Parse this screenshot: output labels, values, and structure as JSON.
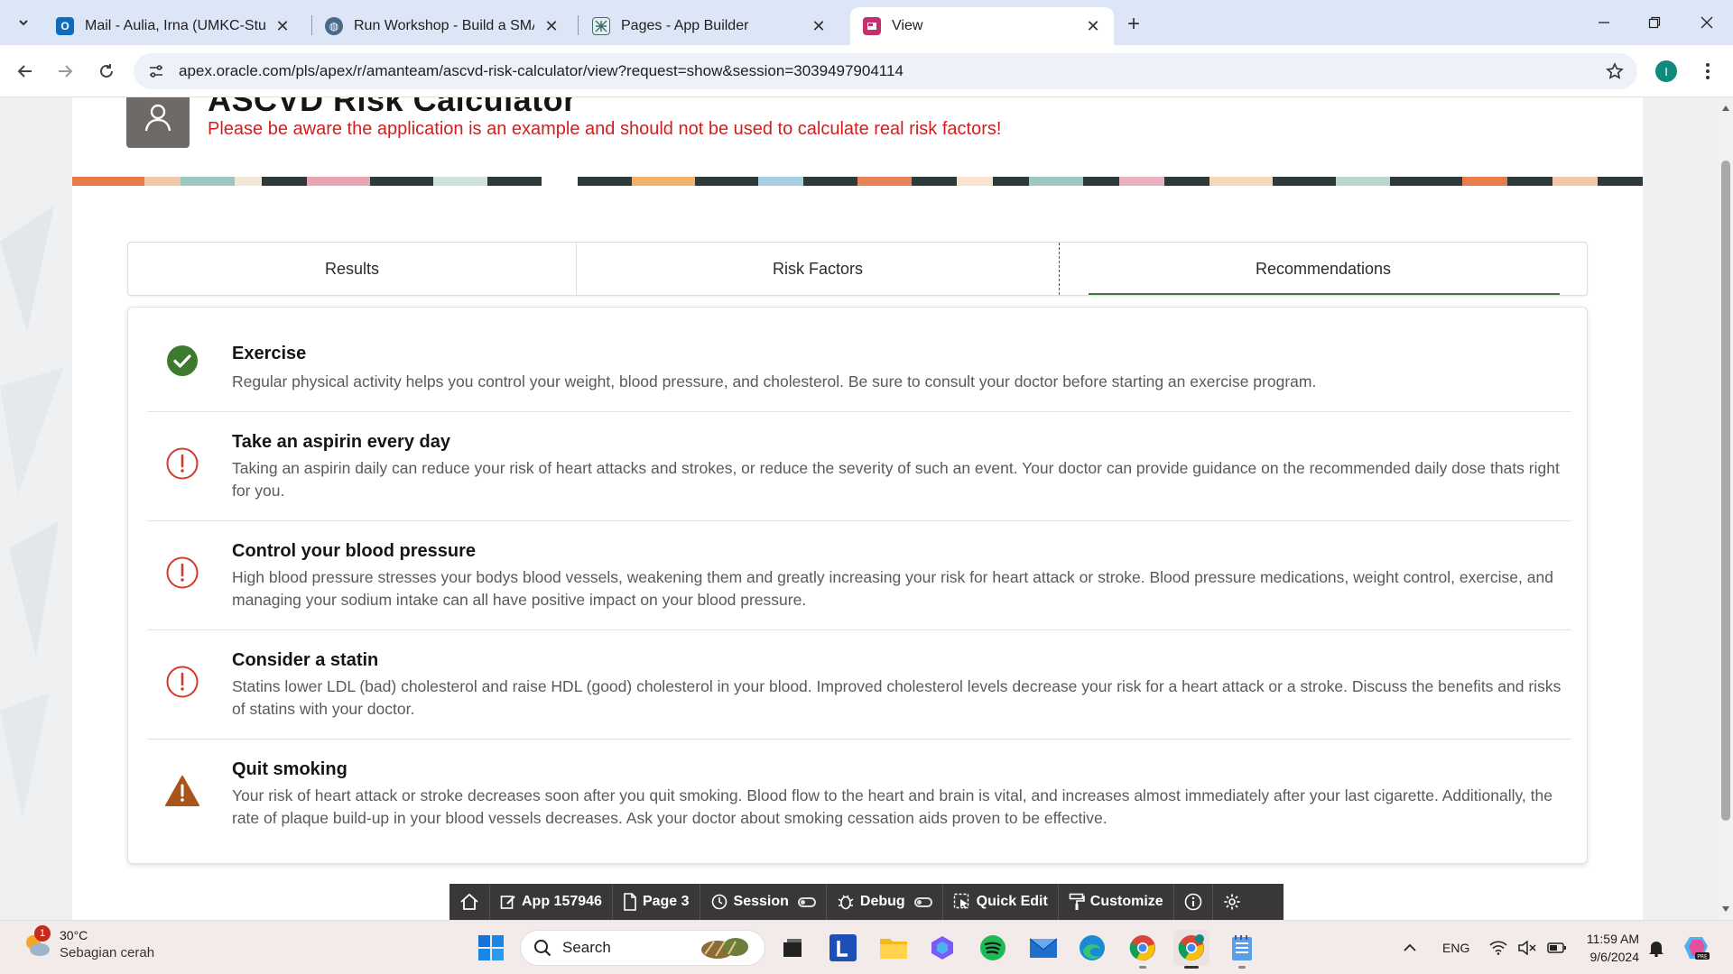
{
  "browser": {
    "tabs": [
      {
        "title": "Mail - Aulia, Irna (UMKC-Studen",
        "icon": "outlook-icon",
        "color": "#0f6cbd"
      },
      {
        "title": "Run Workshop - Build a SMART",
        "icon": "workshop-icon",
        "color": "#4a6a8a"
      },
      {
        "title": "Pages - App Builder",
        "icon": "app-builder-icon",
        "color": "#3f6e6b"
      },
      {
        "title": "View",
        "icon": "apex-app-icon",
        "color": "#c2306d"
      }
    ],
    "address": "apex.oracle.com/pls/apex/r/amanteam/ascvd-risk-calculator/view?request=show&session=3039497904114",
    "profile_initial": "I"
  },
  "hero": {
    "title": "ASCVD Risk Calculator",
    "warning": "Please be aware the application is an example and should not be used to calculate real risk factors!"
  },
  "region_tabs": [
    {
      "label": "Results",
      "active": false
    },
    {
      "label": "Risk Factors",
      "active": false
    },
    {
      "label": "Recommendations",
      "active": true
    }
  ],
  "recommendations": [
    {
      "title": "Exercise",
      "status": "success",
      "icon": "check-circle-icon",
      "description": "Regular physical activity helps you control your weight, blood pressure, and cholesterol. Be sure to consult your doctor before starting an exercise program."
    },
    {
      "title": "Take an aspirin every day",
      "status": "danger",
      "icon": "exclamation-circle-icon",
      "description": "Taking an aspirin daily can reduce your risk of heart attacks and strokes, or reduce the severity of such an event. Your doctor can provide guidance on the recommended daily dose thats right for you."
    },
    {
      "title": "Control your blood pressure",
      "status": "danger",
      "icon": "exclamation-circle-icon",
      "description": "High blood pressure stresses your bodys blood vessels, weakening them and greatly increasing your risk for heart attack or stroke. Blood pressure medications, weight control, exercise, and managing your sodium intake can all have positive impact on your blood pressure."
    },
    {
      "title": "Consider a statin",
      "status": "danger",
      "icon": "exclamation-circle-icon",
      "description": "Statins lower LDL (bad) cholesterol and raise HDL (good) cholesterol in your blood. Improved cholesterol levels decrease your risk for a heart attack or a stroke. Discuss the benefits and risks of statins with your doctor."
    },
    {
      "title": "Quit smoking",
      "status": "warning",
      "icon": "warning-triangle-icon",
      "description": "Your risk of heart attack or stroke decreases soon after you quit smoking. Blood flow to the heart and brain is vital, and increases almost immediately after your last cigarette. Additionally, the rate of plaque build-up in your blood vessels decreases. Ask your doctor about smoking cessation aids proven to be effective."
    }
  ],
  "dev_toolbar": {
    "app": "App 157946",
    "page": "Page 3",
    "session": "Session",
    "debug": "Debug",
    "quick_edit": "Quick Edit",
    "customize": "Customize"
  },
  "taskbar": {
    "weather_temp": "30°C",
    "weather_desc": "Sebagian cerah",
    "weather_badge": "1",
    "search_label": "Search",
    "language": "ENG",
    "time": "11:59 AM",
    "date": "9/6/2024"
  },
  "colors": {
    "success": "#3d7a2e",
    "danger": "#d23a2c",
    "warning": "#a9541b",
    "tab_active_underline": "#3d7a3a",
    "warning_text": "#d11f1f"
  }
}
